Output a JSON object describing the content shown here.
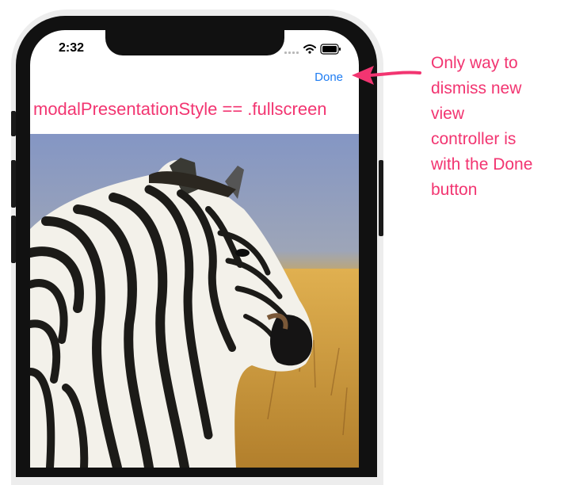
{
  "status_bar": {
    "time": "2:32"
  },
  "nav": {
    "done_label": "Done"
  },
  "content": {
    "title": "modalPresentationStyle == .fullscreen"
  },
  "annotation": {
    "lines": [
      "Only way to",
      "dismiss new",
      "view",
      "controller is",
      "with the Done",
      "button"
    ]
  },
  "icons": {
    "signal": "cellular-signal-icon",
    "wifi": "wifi-icon",
    "battery": "battery-icon"
  },
  "colors": {
    "accent_pink": "#f23571",
    "ios_blue": "#1e7cf2"
  }
}
